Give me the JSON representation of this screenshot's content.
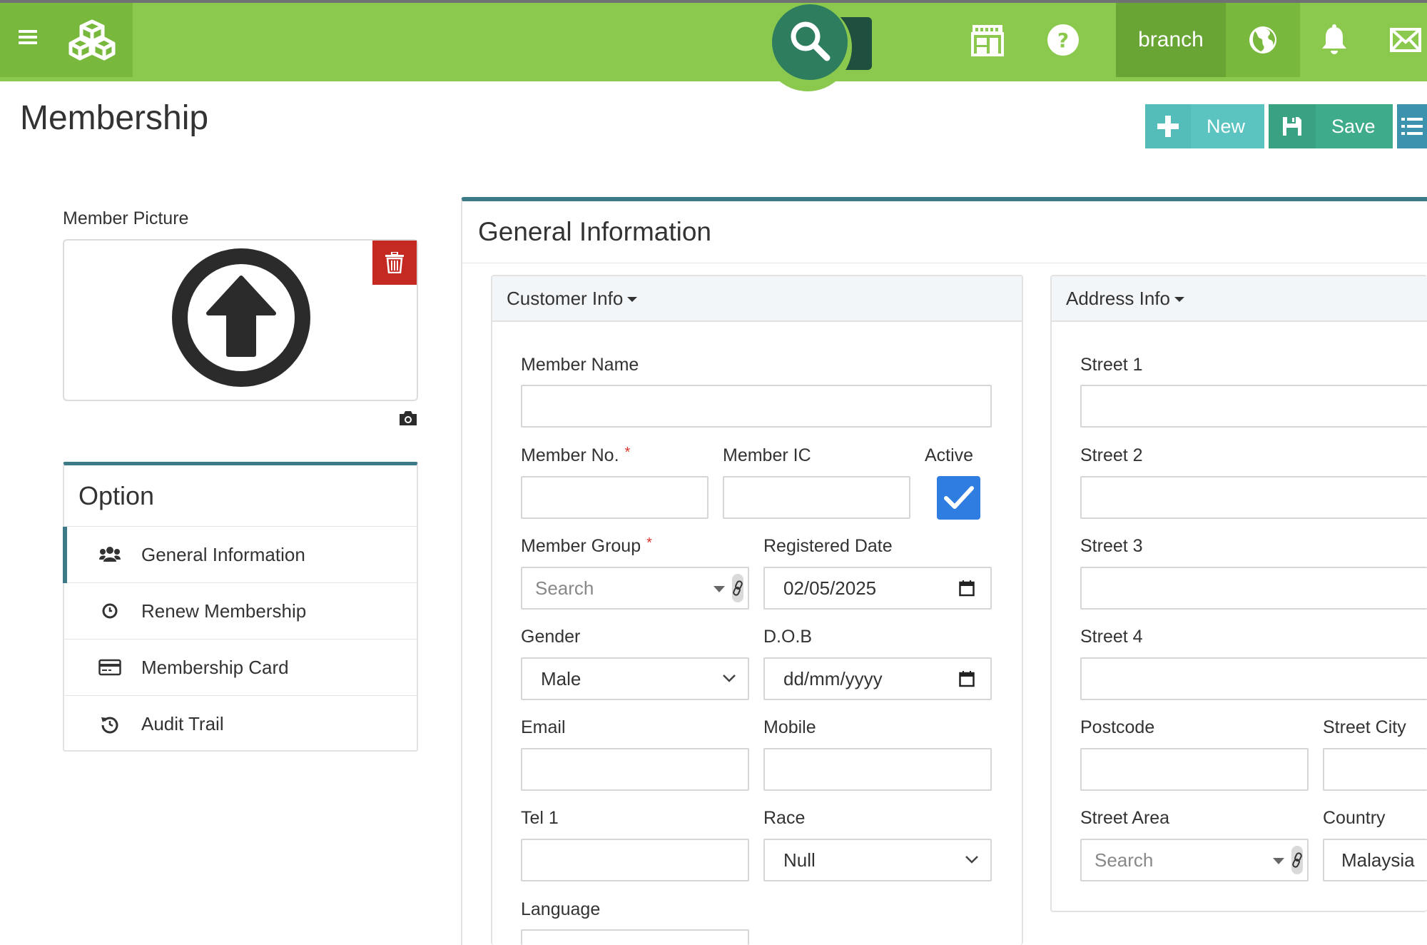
{
  "topbar": {
    "branch_label": "branch"
  },
  "page": {
    "title": "Membership",
    "new_label": "New",
    "save_label": "Save"
  },
  "left": {
    "picture_label": "Member Picture",
    "option_title": "Option",
    "options": [
      {
        "label": "General Information",
        "icon": "users-icon"
      },
      {
        "label": "Renew Membership",
        "icon": "clock-icon"
      },
      {
        "label": "Membership Card",
        "icon": "credit-card-icon"
      },
      {
        "label": "Audit Trail",
        "icon": "history-icon"
      }
    ]
  },
  "general": {
    "title": "General Information",
    "customer_info": {
      "header": "Customer Info",
      "member_name": {
        "label": "Member Name",
        "value": ""
      },
      "member_no": {
        "label": "Member No.",
        "required_mark": "*",
        "value": ""
      },
      "member_ic": {
        "label": "Member IC",
        "value": ""
      },
      "active": {
        "label": "Active",
        "checked": true
      },
      "member_group": {
        "label": "Member Group",
        "required_mark": "*",
        "placeholder": "Search"
      },
      "registered_date": {
        "label": "Registered Date",
        "value": "02/05/2025"
      },
      "gender": {
        "label": "Gender",
        "value": "Male"
      },
      "dob": {
        "label": "D.O.B",
        "placeholder": "dd/mm/yyyy"
      },
      "email": {
        "label": "Email",
        "value": ""
      },
      "mobile": {
        "label": "Mobile",
        "value": ""
      },
      "tel1": {
        "label": "Tel 1",
        "value": ""
      },
      "race": {
        "label": "Race",
        "value": "Null"
      },
      "language": {
        "label": "Language",
        "value": ""
      }
    },
    "address_info": {
      "header": "Address Info",
      "street1": {
        "label": "Street 1",
        "value": ""
      },
      "street2": {
        "label": "Street 2",
        "value": ""
      },
      "street3": {
        "label": "Street 3",
        "value": ""
      },
      "street4": {
        "label": "Street 4",
        "value": ""
      },
      "postcode": {
        "label": "Postcode",
        "value": ""
      },
      "street_city": {
        "label": "Street City",
        "value": ""
      },
      "street_area": {
        "label": "Street Area",
        "placeholder": "Search"
      },
      "country": {
        "label": "Country",
        "value": "Malaysia"
      }
    }
  },
  "colors": {
    "topbar": "#8bc94e",
    "accent": "#3d7a88",
    "new_button": "#5bc4c0",
    "save_button": "#3eab8a",
    "delete_button": "#c42a22",
    "checkbox": "#2f7de1"
  }
}
